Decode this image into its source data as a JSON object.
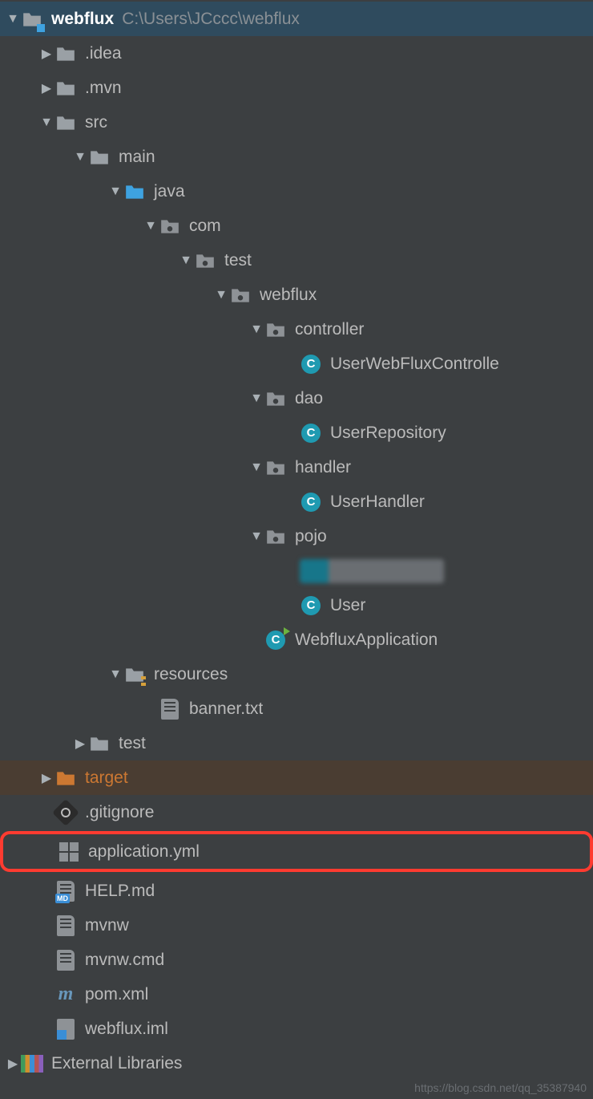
{
  "root": {
    "name": "webflux",
    "path": "C:\\Users\\JCccc\\webflux"
  },
  "tree": {
    "idea": ".idea",
    "mvn": ".mvn",
    "src": "src",
    "main": "main",
    "java": "java",
    "com": "com",
    "test_pkg": "test",
    "webflux_pkg": "webflux",
    "controller": "controller",
    "userwebfluxcontroller": "UserWebFluxControlle",
    "dao": "dao",
    "userrepository": "UserRepository",
    "handler": "handler",
    "userhandler": "UserHandler",
    "pojo": "pojo",
    "user": "User",
    "webfluxapp": "WebfluxApplication",
    "resources": "resources",
    "banner": "banner.txt",
    "test_dir": "test",
    "target": "target",
    "gitignore": ".gitignore",
    "applicationyml": "application.yml",
    "helpmd": "HELP.md",
    "mvnw": "mvnw",
    "mvnwcmd": "mvnw.cmd",
    "pomxml": "pom.xml",
    "webfluximl": "webflux.iml"
  },
  "external_libraries": "External Libraries",
  "watermark": "https://blog.csdn.net/qq_35387940"
}
